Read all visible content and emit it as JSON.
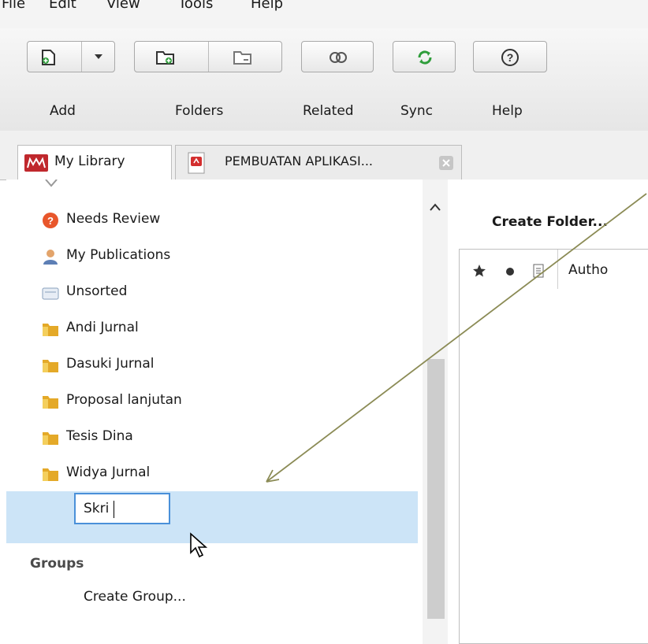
{
  "menu": [
    "File",
    "Edit",
    "View",
    "Tools",
    "Help"
  ],
  "toolbar": {
    "add_label": "Add",
    "folders_label": "Folders",
    "related_label": "Related",
    "sync_label": "Sync",
    "help_label": "Help"
  },
  "tabs": [
    {
      "label": "My Library"
    },
    {
      "label": "PEMBUATAN APLIKASI..."
    }
  ],
  "sidebar": {
    "items": [
      {
        "label": "Needs Review",
        "icon": "needs-review-icon"
      },
      {
        "label": "My Publications",
        "icon": "person-icon"
      },
      {
        "label": "Unsorted",
        "icon": "inbox-icon"
      },
      {
        "label": "Andi Jurnal",
        "icon": "folder-icon"
      },
      {
        "label": "Dasuki Jurnal",
        "icon": "folder-icon"
      },
      {
        "label": "Proposal lanjutan",
        "icon": "folder-icon"
      },
      {
        "label": "Tesis Dina",
        "icon": "folder-icon"
      },
      {
        "label": "Widya Jurnal",
        "icon": "folder-icon"
      }
    ],
    "new_folder_input_value": "Skri",
    "groups_heading": "Groups",
    "create_group_label": "Create Group..."
  },
  "main": {
    "create_folder_label": "Create Folder...",
    "column_author": "Autho"
  },
  "colors": {
    "accent_green": "#2e9d3a",
    "selection_blue": "#cce4f7",
    "folder_yellow": "#e4a928"
  }
}
